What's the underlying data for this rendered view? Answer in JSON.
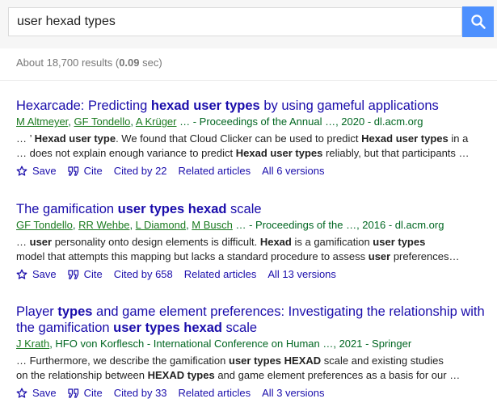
{
  "search": {
    "query": "user hexad types"
  },
  "stats": {
    "prefix": "About 18,700 results (",
    "time": "0.09",
    "suffix": " sec)"
  },
  "links_labels": {
    "save": "Save",
    "cite": "Cite",
    "related": "Related articles"
  },
  "results": [
    {
      "title": [
        {
          "t": "Hexarcade: Predicting ",
          "b": false
        },
        {
          "t": "hexad user types",
          "b": true
        },
        {
          "t": " by using gameful applications",
          "b": false
        }
      ],
      "authors": [
        "M Altmeyer",
        "GF Tondello",
        "A Krüger"
      ],
      "source": "… - Proceedings of the Annual …, 2020 - dl.acm.org",
      "snippet": [
        [
          {
            "t": "… ’ ",
            "b": false
          },
          {
            "t": "Hexad user type",
            "b": true
          },
          {
            "t": ". We found that Cloud Clicker can be used to predict ",
            "b": false
          },
          {
            "t": "Hexad user types",
            "b": true
          },
          {
            "t": " in a",
            "b": false
          }
        ],
        [
          {
            "t": "… does not explain enough variance to predict ",
            "b": false
          },
          {
            "t": "Hexad user types",
            "b": true
          },
          {
            "t": " reliably, but that participants …",
            "b": false
          }
        ]
      ],
      "cited": "Cited by 22",
      "versions": "All 6 versions"
    },
    {
      "title": [
        {
          "t": "The gamification ",
          "b": false
        },
        {
          "t": "user types hexad",
          "b": true
        },
        {
          "t": " scale",
          "b": false
        }
      ],
      "authors": [
        "GF Tondello",
        "RR Wehbe",
        "L Diamond",
        "M Busch"
      ],
      "source": "… - Proceedings of the …, 2016 - dl.acm.org",
      "snippet": [
        [
          {
            "t": "… ",
            "b": false
          },
          {
            "t": "user",
            "b": true
          },
          {
            "t": " personality onto design elements is difficult. ",
            "b": false
          },
          {
            "t": "Hexad",
            "b": true
          },
          {
            "t": " is a gamification ",
            "b": false
          },
          {
            "t": "user types",
            "b": true
          }
        ],
        [
          {
            "t": "model that attempts this mapping but lacks a standard procedure to assess ",
            "b": false
          },
          {
            "t": "user",
            "b": true
          },
          {
            "t": " preferences…",
            "b": false
          }
        ]
      ],
      "cited": "Cited by 658",
      "versions": "All 13 versions"
    },
    {
      "title": [
        {
          "t": "Player ",
          "b": false
        },
        {
          "t": "types",
          "b": true
        },
        {
          "t": " and game element preferences: Investigating the relationship with",
          "b": false
        }
      ],
      "title2": [
        {
          "t": "the gamification ",
          "b": false
        },
        {
          "t": "user types hexad",
          "b": true
        },
        {
          "t": " scale",
          "b": false
        }
      ],
      "authors": [
        "J Krath"
      ],
      "source": ", HFO von Korflesch - International Conference on Human …, 2021 - Springer",
      "snippet": [
        [
          {
            "t": "… Furthermore, we describe the gamification ",
            "b": false
          },
          {
            "t": "user types HEXAD",
            "b": true
          },
          {
            "t": " scale and existing studies",
            "b": false
          }
        ],
        [
          {
            "t": "on the relationship between ",
            "b": false
          },
          {
            "t": "HEXAD types",
            "b": true
          },
          {
            "t": " and game element preferences as a basis for our …",
            "b": false
          }
        ]
      ],
      "cited": "Cited by 33",
      "versions": "All 3 versions"
    }
  ]
}
